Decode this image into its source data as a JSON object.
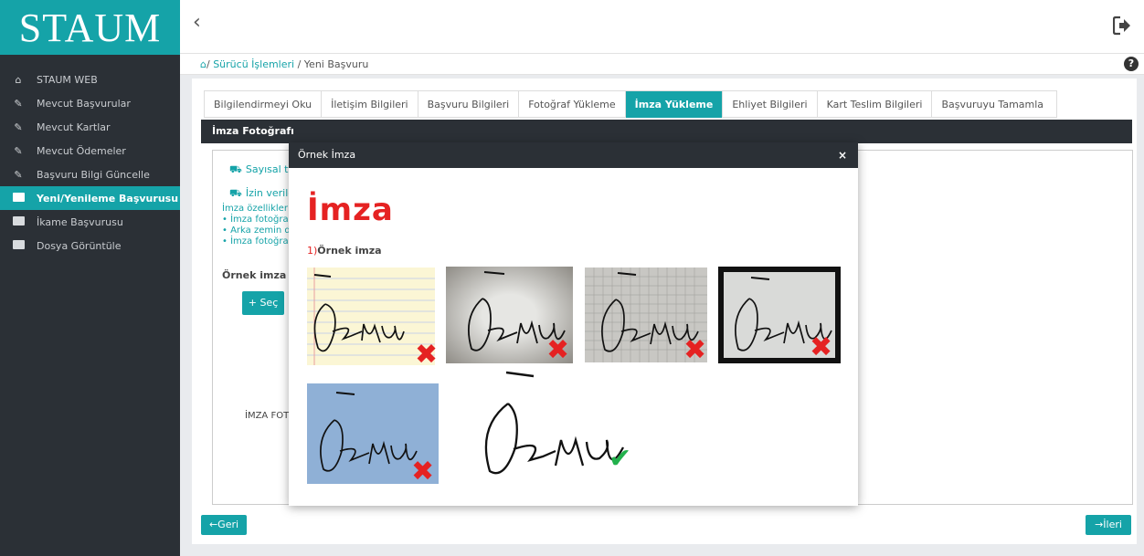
{
  "app": {
    "logo": "STAUM"
  },
  "sidebar": {
    "items": [
      {
        "label": "STAUM WEB",
        "icon": "home-icon"
      },
      {
        "label": "Mevcut Başvurular",
        "icon": "edit-icon"
      },
      {
        "label": "Mevcut Kartlar",
        "icon": "edit-icon"
      },
      {
        "label": "Mevcut Ödemeler",
        "icon": "edit-icon"
      },
      {
        "label": "Başvuru Bilgi Güncelle",
        "icon": "edit-icon"
      },
      {
        "label": "Yeni/Yenileme Başvurusu",
        "icon": "id-card-icon",
        "active": true
      },
      {
        "label": "İkame Başvurusu",
        "icon": "id-card-icon"
      },
      {
        "label": "Dosya Görüntüle",
        "icon": "id-card-icon"
      }
    ]
  },
  "breadcrumb": {
    "home": "/",
    "link": "Sürücü İşlemleri",
    "sep": " / ",
    "current": "Yeni Başvuru"
  },
  "tabs": [
    "Bilgilendirmeyi Oku",
    "İletişim Bilgileri",
    "Başvuru Bilgileri",
    "Fotoğraf Yükleme",
    "İmza Yükleme",
    "Ehliyet Bilgileri",
    "Kart Teslim Bilgileri",
    "Başvuruyu Tamamla"
  ],
  "active_tab": "İmza Yükleme",
  "section": {
    "title": "İmza Fotoğrafı",
    "line1": "Sayısal ta",
    "line2": "İzin verile",
    "details": [
      "İmza özellikler",
      "• İmza fotoğra",
      "• Arka zemin d",
      "• İmza fotoğra"
    ],
    "ornek_label": "Örnek imza i",
    "sec_button": "Seç",
    "imza_foto_label": "İMZA FOT"
  },
  "nav": {
    "back": "Geri",
    "next": "İleri"
  },
  "modal": {
    "title": "Örnek İmza",
    "close": "×",
    "heading": "İmza",
    "sub_num": "1)",
    "sub_text": "Örnek imza",
    "signature_text": "Öenus",
    "samples": [
      {
        "background": "lined-yellow-paper",
        "valid": false
      },
      {
        "background": "grey-shadowed-paper",
        "valid": false
      },
      {
        "background": "grid-paper",
        "valid": false
      },
      {
        "background": "dark-bordered-paper",
        "valid": false
      },
      {
        "background": "blue-paper",
        "valid": false
      },
      {
        "background": "white",
        "valid": true
      }
    ]
  },
  "colors": {
    "accent": "#15a3a8",
    "dark": "#2b3036",
    "error": "#e52222",
    "ok": "#22b14c"
  }
}
